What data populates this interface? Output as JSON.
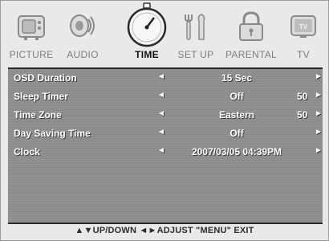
{
  "tabs": [
    {
      "label": "PICTURE",
      "icon": "tv-set-icon",
      "active": false
    },
    {
      "label": "AUDIO",
      "icon": "speaker-icon",
      "active": false
    },
    {
      "label": "TIME",
      "icon": "stopwatch-icon",
      "active": true
    },
    {
      "label": "SET UP",
      "icon": "tools-icon",
      "active": false
    },
    {
      "label": "PARENTAL",
      "icon": "padlock-icon",
      "active": false
    },
    {
      "label": "TV",
      "icon": "tv-screen-icon",
      "active": false
    }
  ],
  "settings": [
    {
      "label": "OSD Duration",
      "value": "15 Sec",
      "num": ""
    },
    {
      "label": "Sleep Timer",
      "value": "Off",
      "num": "50"
    },
    {
      "label": "Time Zone",
      "value": "Eastern",
      "num": "50"
    },
    {
      "label": "Day Saving Time",
      "value": "Off",
      "num": ""
    },
    {
      "label": "Clock",
      "value": "2007/03/05 04:39PM",
      "num": ""
    }
  ],
  "footer": {
    "text": "▲▼UP/DOWN  ◄►ADJUST  \"MENU\" EXIT"
  },
  "colors": {
    "panel": "#8c8c8c",
    "active_tab_text": "#111111",
    "inactive_tab_text": "#7d7d7d"
  }
}
